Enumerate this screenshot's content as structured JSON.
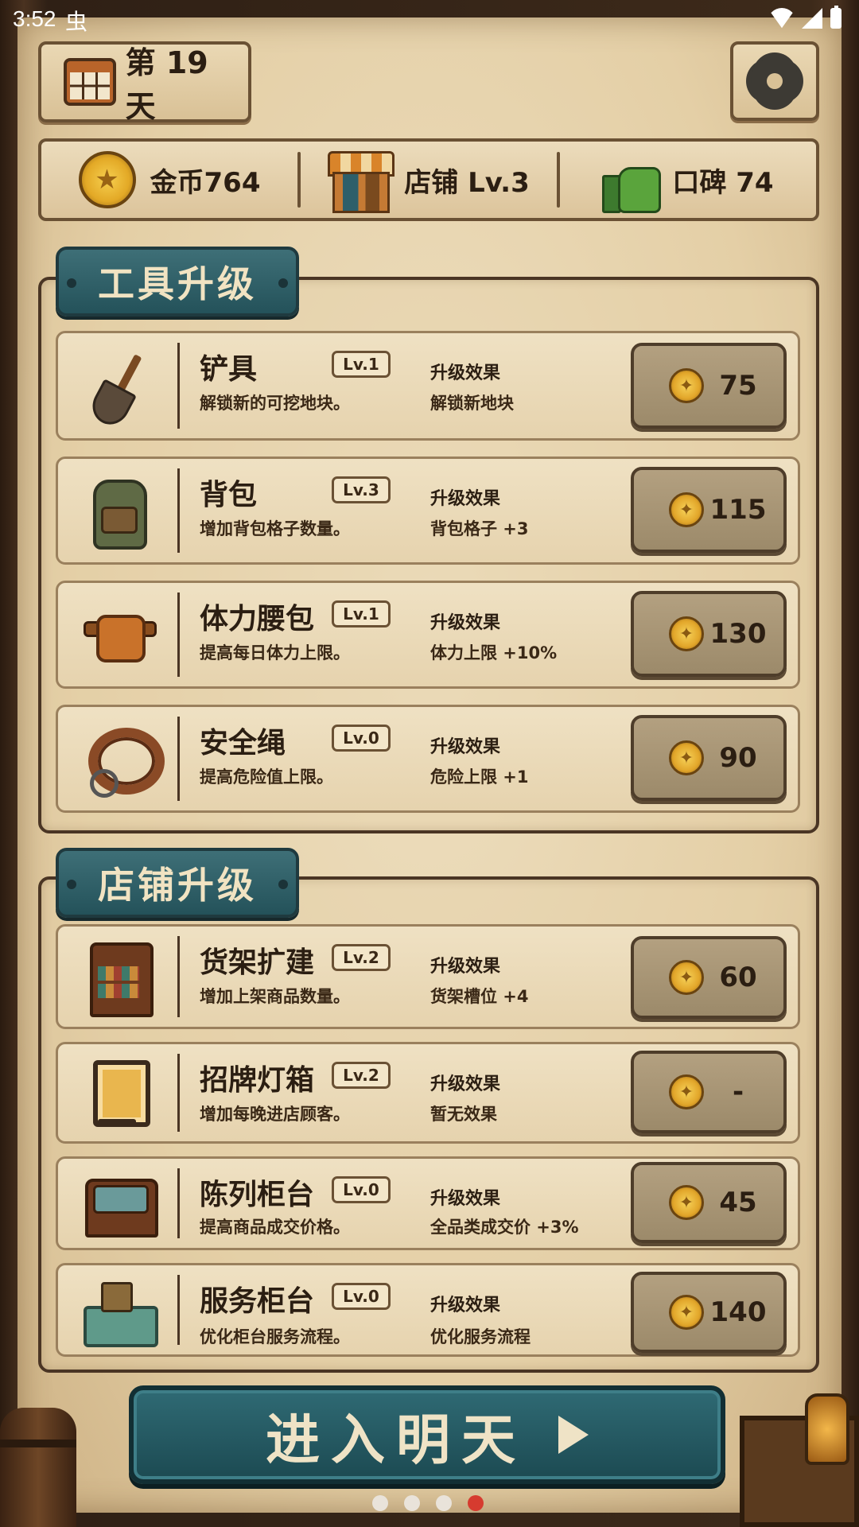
{
  "status_bar": {
    "time": "3:52",
    "debug_glyph": "虫"
  },
  "header": {
    "day_label": "第 19 天",
    "settings_icon": "gear-icon"
  },
  "stats": {
    "gold": "金币764",
    "shop": "店铺 Lv.3",
    "reputation": "口碑 74"
  },
  "tool_upgrades": {
    "title": "工具升级",
    "items": [
      {
        "name": "铲具",
        "level": "Lv.1",
        "desc": "解锁新的可挖地块。",
        "effect_title": "升级效果",
        "effect": "解锁新地块",
        "price": "75",
        "icon": "shovel-icon"
      },
      {
        "name": "背包",
        "level": "Lv.3",
        "desc": "增加背包格子数量。",
        "effect_title": "升级效果",
        "effect": "背包格子 +3",
        "price": "115",
        "icon": "backpack-icon"
      },
      {
        "name": "体力腰包",
        "level": "Lv.1",
        "desc": "提高每日体力上限。",
        "effect_title": "升级效果",
        "effect": "体力上限 +10%",
        "price": "130",
        "icon": "belt-bag-icon"
      },
      {
        "name": "安全绳",
        "level": "Lv.0",
        "desc": "提高危险值上限。",
        "effect_title": "升级效果",
        "effect": "危险上限 +1",
        "price": "90",
        "icon": "rope-icon"
      }
    ]
  },
  "shop_upgrades": {
    "title": "店铺升级",
    "items": [
      {
        "name": "货架扩建",
        "level": "Lv.2",
        "desc": "增加上架商品数量。",
        "effect_title": "升级效果",
        "effect": "货架槽位 +4",
        "price": "60",
        "icon": "shelf-icon"
      },
      {
        "name": "招牌灯箱",
        "level": "Lv.2",
        "desc": "增加每晚进店顾客。",
        "effect_title": "升级效果",
        "effect": "暂无效果",
        "price": "-",
        "icon": "sign-lightbox-icon"
      },
      {
        "name": "陈列柜台",
        "level": "Lv.0",
        "desc": "提高商品成交价格。",
        "effect_title": "升级效果",
        "effect": "全品类成交价 +3%",
        "price": "45",
        "icon": "display-case-icon"
      },
      {
        "name": "服务柜台",
        "level": "Lv.0",
        "desc": "优化柜台服务流程。",
        "effect_title": "升级效果",
        "effect": "优化服务流程",
        "price": "140",
        "icon": "service-counter-icon"
      }
    ]
  },
  "cta": {
    "label": "进入明天"
  },
  "pager": {
    "count": 4,
    "active_index": 3,
    "active_color": "#d63b2f"
  }
}
